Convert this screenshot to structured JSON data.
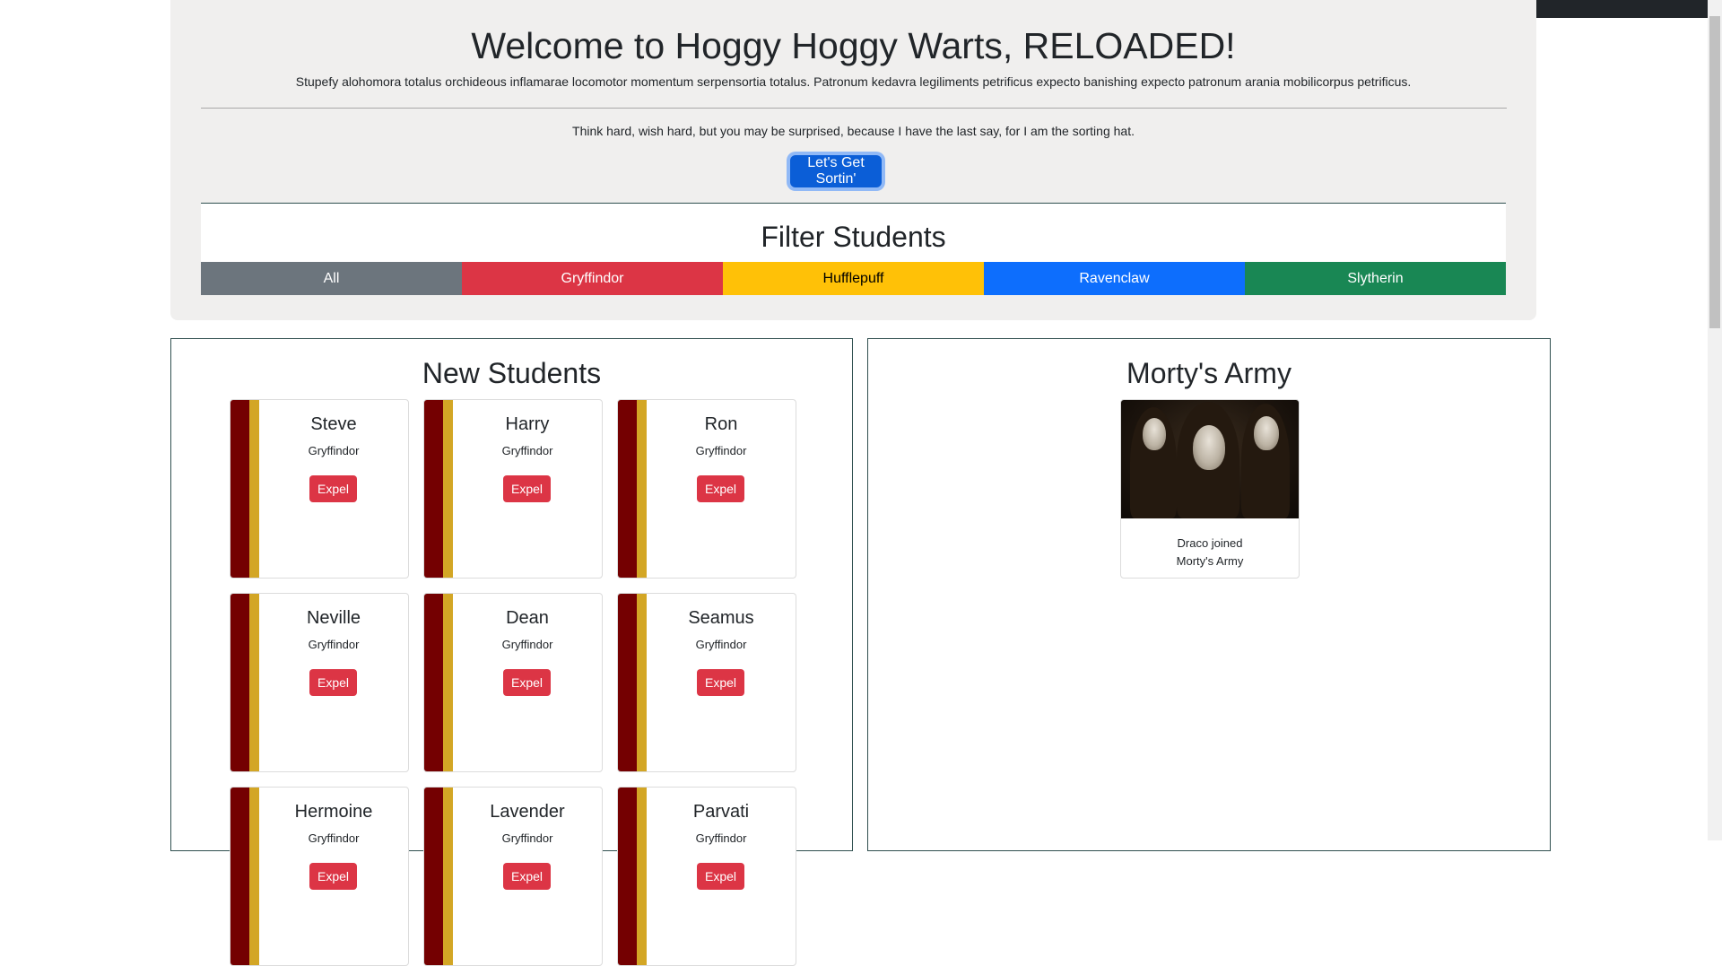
{
  "header": {
    "title": "Welcome to Hoggy Hoggy Warts, RELOADED!",
    "lead": "Stupefy alohomora totalus orchideous inflamarae locomotor momentum serpensortia totalus. Patronum kedavra legiliments petrificus expecto banishing expecto patronum arania mobilicorpus petrificus.",
    "hat_text": "Think hard, wish hard, but you may be surprised, because I have the last say, for I am the sorting hat.",
    "sort_button": "Let's Get Sortin'"
  },
  "filter": {
    "title": "Filter Students",
    "buttons": [
      {
        "label": "All",
        "color": "#6c757d",
        "text_color": "#ffffff"
      },
      {
        "label": "Gryffindor",
        "color": "#dc3545",
        "text_color": "#ffffff"
      },
      {
        "label": "Hufflepuff",
        "color": "#ffc107",
        "text_color": "#000000"
      },
      {
        "label": "Ravenclaw",
        "color": "#0d6efd",
        "text_color": "#ffffff"
      },
      {
        "label": "Slytherin",
        "color": "#198754",
        "text_color": "#ffffff"
      }
    ]
  },
  "new_students": {
    "title": "New Students",
    "expel_label": "Expel",
    "students": [
      {
        "name": "Steve",
        "house": "Gryffindor"
      },
      {
        "name": "Harry",
        "house": "Gryffindor"
      },
      {
        "name": "Ron",
        "house": "Gryffindor"
      },
      {
        "name": "Neville",
        "house": "Gryffindor"
      },
      {
        "name": "Dean",
        "house": "Gryffindor"
      },
      {
        "name": "Seamus",
        "house": "Gryffindor"
      },
      {
        "name": "Hermoine",
        "house": "Gryffindor"
      },
      {
        "name": "Lavender",
        "house": "Gryffindor"
      },
      {
        "name": "Parvati",
        "house": "Gryffindor"
      }
    ],
    "colors": {
      "primary": "#740001",
      "secondary": "#d3a625"
    }
  },
  "army": {
    "title": "Morty's Army",
    "members": [
      {
        "text": "Draco joined Morty's Army",
        "image": "death-eaters-image"
      }
    ]
  }
}
